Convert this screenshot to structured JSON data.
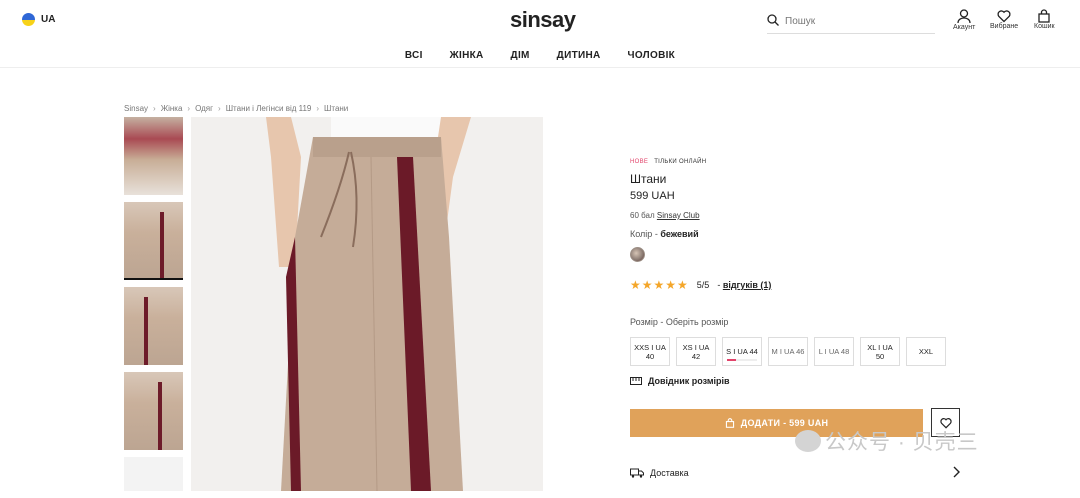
{
  "header": {
    "locale": "UA",
    "logo": "sinsay",
    "search_placeholder": "Пошук",
    "account_label": "Акаунт",
    "wishlist_label": "Вибране",
    "cart_label": "Кошик"
  },
  "nav": [
    "ВСІ",
    "ЖІНКА",
    "ДІМ",
    "ДИТИНА",
    "ЧОЛОВІК"
  ],
  "breadcrumbs": [
    "Sinsay",
    "Жінка",
    "Одяг",
    "Штани і Легінси від 119",
    "Штани"
  ],
  "product": {
    "tag_new": "НОВЕ",
    "tag_online": "ТІЛЬКИ ОНЛАЙН",
    "title": "Штани",
    "price": "599 UAH",
    "club_points": "60 бал",
    "club_link": "Sinsay Club",
    "color_label": "Колір",
    "color_value": "бежевий",
    "rating_value": "5/5",
    "reviews_link": "відгуків (1)",
    "size_label": "Розмір - Оберіть розмір",
    "sizes": [
      {
        "line1": "XXS I UA",
        "line2": "40"
      },
      {
        "line1": "XS I UA",
        "line2": "42"
      },
      {
        "line1": "S I UA 44",
        "line2": ""
      },
      {
        "line1": "M I UA 46",
        "line2": ""
      },
      {
        "line1": "L I UA 48",
        "line2": ""
      },
      {
        "line1": "XL I UA",
        "line2": "50"
      },
      {
        "line1": "XXL",
        "line2": ""
      }
    ],
    "size_guide": "Довідник розмірів",
    "add_button": "ДОДАТИ - 599 UAH",
    "delivery": "Доставка"
  },
  "watermark": "公众号 · 贝壳三",
  "colors": {
    "accent": "#e0a25a",
    "new_tag": "#e2436a",
    "stars": "#f4a62a"
  }
}
